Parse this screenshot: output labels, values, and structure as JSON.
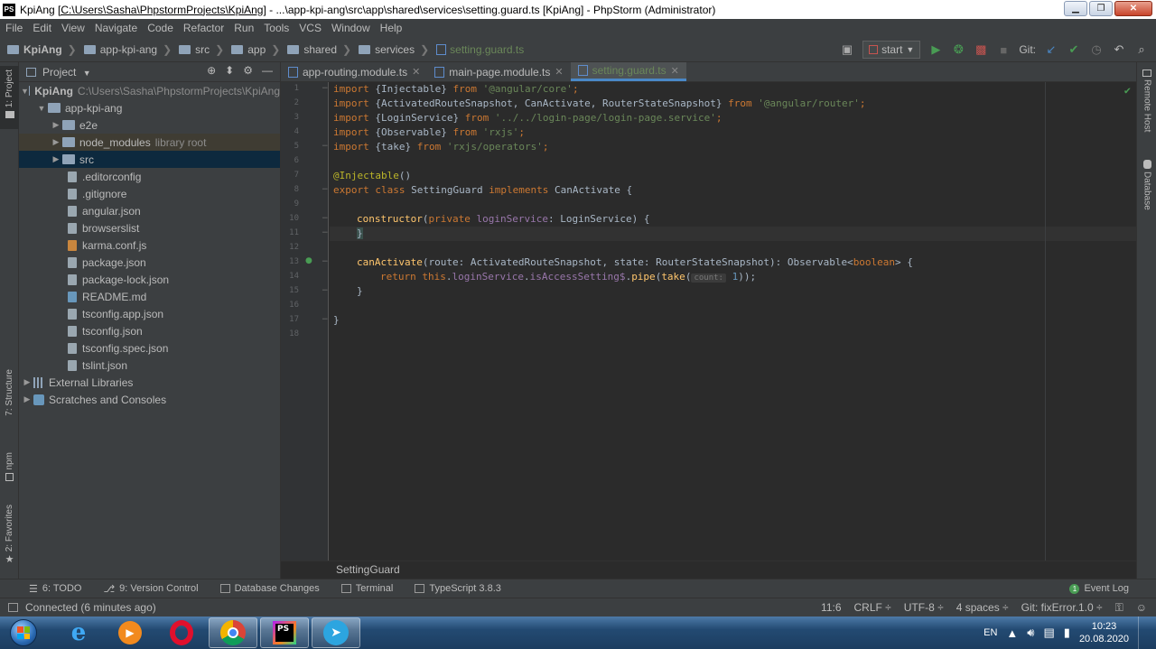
{
  "titlebar": {
    "logo": "PS",
    "project": "KpiAng",
    "path_highlight": "[C:\\Users\\Sasha\\PhpstormProjects\\KpiAng]",
    "rest": " - ...\\app-kpi-ang\\src\\app\\shared\\services\\setting.guard.ts [KpiAng] - PhpStorm (Administrator)"
  },
  "menu": [
    "File",
    "Edit",
    "View",
    "Navigate",
    "Code",
    "Refactor",
    "Run",
    "Tools",
    "VCS",
    "Window",
    "Help"
  ],
  "navbar": {
    "crumbs": [
      "KpiAng",
      "app-kpi-ang",
      "src",
      "app",
      "shared",
      "services"
    ],
    "file": "setting.guard.ts",
    "run_config": "start",
    "git_label": "Git:"
  },
  "left_tabs": {
    "project": "1: Project",
    "structure": "7: Structure",
    "npm": "npm",
    "favorites": "2: Favorites"
  },
  "right_tabs": {
    "remote_host": "Remote Host",
    "database": "Database"
  },
  "project_panel": {
    "title": "Project",
    "root_name": "KpiAng",
    "root_path": "C:\\Users\\Sasha\\PhpstormProjects\\KpiAng",
    "app_folder": "app-kpi-ang",
    "e2e": "e2e",
    "node_modules": "node_modules",
    "node_modules_note": "library root",
    "src": "src",
    "files": [
      ".editorconfig",
      ".gitignore",
      "angular.json",
      "browserslist",
      "karma.conf.js",
      "package.json",
      "package-lock.json",
      "README.md",
      "tsconfig.app.json",
      "tsconfig.json",
      "tsconfig.spec.json",
      "tslint.json"
    ],
    "external_libraries": "External Libraries",
    "scratches": "Scratches and Consoles"
  },
  "tabs": [
    {
      "label": "app-routing.module.ts"
    },
    {
      "label": "main-page.module.ts"
    },
    {
      "label": "setting.guard.ts"
    }
  ],
  "line_numbers": [
    "1",
    "2",
    "3",
    "4",
    "5",
    "6",
    "7",
    "8",
    "9",
    "10",
    "11",
    "12",
    "13",
    "14",
    "15",
    "16",
    "17",
    "18"
  ],
  "code": {
    "l1": {
      "kw1": "import",
      "a": " {Injectable} ",
      "kw2": "from",
      "s": " '@angular/core'",
      "e": ";"
    },
    "l2": {
      "kw1": "import",
      "a": " {ActivatedRouteSnapshot, CanActivate, RouterStateSnapshot} ",
      "kw2": "from",
      "s": " '@angular/router'",
      "e": ";"
    },
    "l3": {
      "kw1": "import",
      "a": " {LoginService} ",
      "kw2": "from",
      "s": " '../../login-page/login-page.service'",
      "e": ";"
    },
    "l4": {
      "kw1": "import",
      "a": " {Observable} ",
      "kw2": "from",
      "s": " 'rxjs'",
      "e": ";"
    },
    "l5": {
      "kw1": "import",
      "a": " {take} ",
      "kw2": "from",
      "s": " 'rxjs/operators'",
      "e": ";"
    },
    "l7": {
      "ann": "@Injectable",
      "e": "()"
    },
    "l8": {
      "kw1": "export class ",
      "cls": "SettingGuard ",
      "kw2": "implements ",
      "iface": "CanActivate {"
    },
    "l10": {
      "fn": "constructor",
      "p1": "(",
      "kw": "private ",
      "fld": "loginService",
      "rest": ": LoginService) {"
    },
    "l11": {
      "txt": "}"
    },
    "l13": {
      "fn": "canActivate",
      "rest1": "(route: ActivatedRouteSnapshot, state: RouterStateSnapshot): Observable<",
      "kw": "boolean",
      "rest2": "> {"
    },
    "l14": {
      "kw": "return ",
      "kw2": "this",
      "dot": ".",
      "fld": "loginService",
      "dot2": ".",
      "fld2": "isAccessSetting$",
      "p": ".",
      "fn": "pipe",
      "p2": "(",
      "fn2": "take",
      "p3": "(",
      "hint": "count:",
      "num": " 1",
      "end": "));"
    },
    "l15": {
      "txt": "}"
    },
    "l17": {
      "txt": "}"
    }
  },
  "editor_breadcrumb": "SettingGuard",
  "tool_windows": {
    "todo": "6: TODO",
    "vcs": "9: Version Control",
    "db_changes": "Database Changes",
    "terminal": "Terminal",
    "typescript": "TypeScript 3.8.3",
    "event_log": "Event Log"
  },
  "status": {
    "message": "Connected (6 minutes ago)",
    "position": "11:6",
    "line_sep": "CRLF ÷",
    "encoding": "UTF-8 ÷",
    "indent": "4 spaces ÷",
    "git_branch": "Git: fixError.1.0 ÷"
  },
  "tray": {
    "lang": "EN",
    "time": "10:23",
    "date": "20.08.2020"
  },
  "colors": {
    "editor_bg": "#2b2b2b",
    "panel_bg": "#3c3f41",
    "keyword": "#cc7832",
    "string": "#6a8759",
    "function": "#ffc66d",
    "annotation": "#bbb529",
    "field": "#9876aa"
  }
}
